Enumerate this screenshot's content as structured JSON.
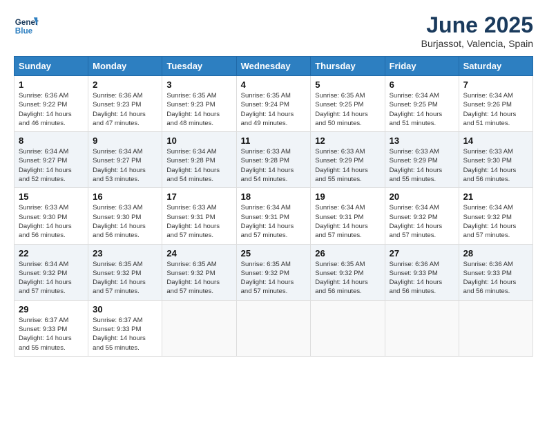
{
  "logo": {
    "line1": "General",
    "line2": "Blue"
  },
  "title": "June 2025",
  "location": "Burjassot, Valencia, Spain",
  "weekdays": [
    "Sunday",
    "Monday",
    "Tuesday",
    "Wednesday",
    "Thursday",
    "Friday",
    "Saturday"
  ],
  "weeks": [
    [
      {
        "day": "1",
        "sunrise": "Sunrise: 6:36 AM",
        "sunset": "Sunset: 9:22 PM",
        "daylight": "Daylight: 14 hours and 46 minutes."
      },
      {
        "day": "2",
        "sunrise": "Sunrise: 6:36 AM",
        "sunset": "Sunset: 9:23 PM",
        "daylight": "Daylight: 14 hours and 47 minutes."
      },
      {
        "day": "3",
        "sunrise": "Sunrise: 6:35 AM",
        "sunset": "Sunset: 9:23 PM",
        "daylight": "Daylight: 14 hours and 48 minutes."
      },
      {
        "day": "4",
        "sunrise": "Sunrise: 6:35 AM",
        "sunset": "Sunset: 9:24 PM",
        "daylight": "Daylight: 14 hours and 49 minutes."
      },
      {
        "day": "5",
        "sunrise": "Sunrise: 6:35 AM",
        "sunset": "Sunset: 9:25 PM",
        "daylight": "Daylight: 14 hours and 50 minutes."
      },
      {
        "day": "6",
        "sunrise": "Sunrise: 6:34 AM",
        "sunset": "Sunset: 9:25 PM",
        "daylight": "Daylight: 14 hours and 51 minutes."
      },
      {
        "day": "7",
        "sunrise": "Sunrise: 6:34 AM",
        "sunset": "Sunset: 9:26 PM",
        "daylight": "Daylight: 14 hours and 51 minutes."
      }
    ],
    [
      {
        "day": "8",
        "sunrise": "Sunrise: 6:34 AM",
        "sunset": "Sunset: 9:27 PM",
        "daylight": "Daylight: 14 hours and 52 minutes."
      },
      {
        "day": "9",
        "sunrise": "Sunrise: 6:34 AM",
        "sunset": "Sunset: 9:27 PM",
        "daylight": "Daylight: 14 hours and 53 minutes."
      },
      {
        "day": "10",
        "sunrise": "Sunrise: 6:34 AM",
        "sunset": "Sunset: 9:28 PM",
        "daylight": "Daylight: 14 hours and 54 minutes."
      },
      {
        "day": "11",
        "sunrise": "Sunrise: 6:33 AM",
        "sunset": "Sunset: 9:28 PM",
        "daylight": "Daylight: 14 hours and 54 minutes."
      },
      {
        "day": "12",
        "sunrise": "Sunrise: 6:33 AM",
        "sunset": "Sunset: 9:29 PM",
        "daylight": "Daylight: 14 hours and 55 minutes."
      },
      {
        "day": "13",
        "sunrise": "Sunrise: 6:33 AM",
        "sunset": "Sunset: 9:29 PM",
        "daylight": "Daylight: 14 hours and 55 minutes."
      },
      {
        "day": "14",
        "sunrise": "Sunrise: 6:33 AM",
        "sunset": "Sunset: 9:30 PM",
        "daylight": "Daylight: 14 hours and 56 minutes."
      }
    ],
    [
      {
        "day": "15",
        "sunrise": "Sunrise: 6:33 AM",
        "sunset": "Sunset: 9:30 PM",
        "daylight": "Daylight: 14 hours and 56 minutes."
      },
      {
        "day": "16",
        "sunrise": "Sunrise: 6:33 AM",
        "sunset": "Sunset: 9:30 PM",
        "daylight": "Daylight: 14 hours and 56 minutes."
      },
      {
        "day": "17",
        "sunrise": "Sunrise: 6:33 AM",
        "sunset": "Sunset: 9:31 PM",
        "daylight": "Daylight: 14 hours and 57 minutes."
      },
      {
        "day": "18",
        "sunrise": "Sunrise: 6:34 AM",
        "sunset": "Sunset: 9:31 PM",
        "daylight": "Daylight: 14 hours and 57 minutes."
      },
      {
        "day": "19",
        "sunrise": "Sunrise: 6:34 AM",
        "sunset": "Sunset: 9:31 PM",
        "daylight": "Daylight: 14 hours and 57 minutes."
      },
      {
        "day": "20",
        "sunrise": "Sunrise: 6:34 AM",
        "sunset": "Sunset: 9:32 PM",
        "daylight": "Daylight: 14 hours and 57 minutes."
      },
      {
        "day": "21",
        "sunrise": "Sunrise: 6:34 AM",
        "sunset": "Sunset: 9:32 PM",
        "daylight": "Daylight: 14 hours and 57 minutes."
      }
    ],
    [
      {
        "day": "22",
        "sunrise": "Sunrise: 6:34 AM",
        "sunset": "Sunset: 9:32 PM",
        "daylight": "Daylight: 14 hours and 57 minutes."
      },
      {
        "day": "23",
        "sunrise": "Sunrise: 6:35 AM",
        "sunset": "Sunset: 9:32 PM",
        "daylight": "Daylight: 14 hours and 57 minutes."
      },
      {
        "day": "24",
        "sunrise": "Sunrise: 6:35 AM",
        "sunset": "Sunset: 9:32 PM",
        "daylight": "Daylight: 14 hours and 57 minutes."
      },
      {
        "day": "25",
        "sunrise": "Sunrise: 6:35 AM",
        "sunset": "Sunset: 9:32 PM",
        "daylight": "Daylight: 14 hours and 57 minutes."
      },
      {
        "day": "26",
        "sunrise": "Sunrise: 6:35 AM",
        "sunset": "Sunset: 9:32 PM",
        "daylight": "Daylight: 14 hours and 56 minutes."
      },
      {
        "day": "27",
        "sunrise": "Sunrise: 6:36 AM",
        "sunset": "Sunset: 9:33 PM",
        "daylight": "Daylight: 14 hours and 56 minutes."
      },
      {
        "day": "28",
        "sunrise": "Sunrise: 6:36 AM",
        "sunset": "Sunset: 9:33 PM",
        "daylight": "Daylight: 14 hours and 56 minutes."
      }
    ],
    [
      {
        "day": "29",
        "sunrise": "Sunrise: 6:37 AM",
        "sunset": "Sunset: 9:33 PM",
        "daylight": "Daylight: 14 hours and 55 minutes."
      },
      {
        "day": "30",
        "sunrise": "Sunrise: 6:37 AM",
        "sunset": "Sunset: 9:33 PM",
        "daylight": "Daylight: 14 hours and 55 minutes."
      },
      null,
      null,
      null,
      null,
      null
    ]
  ]
}
